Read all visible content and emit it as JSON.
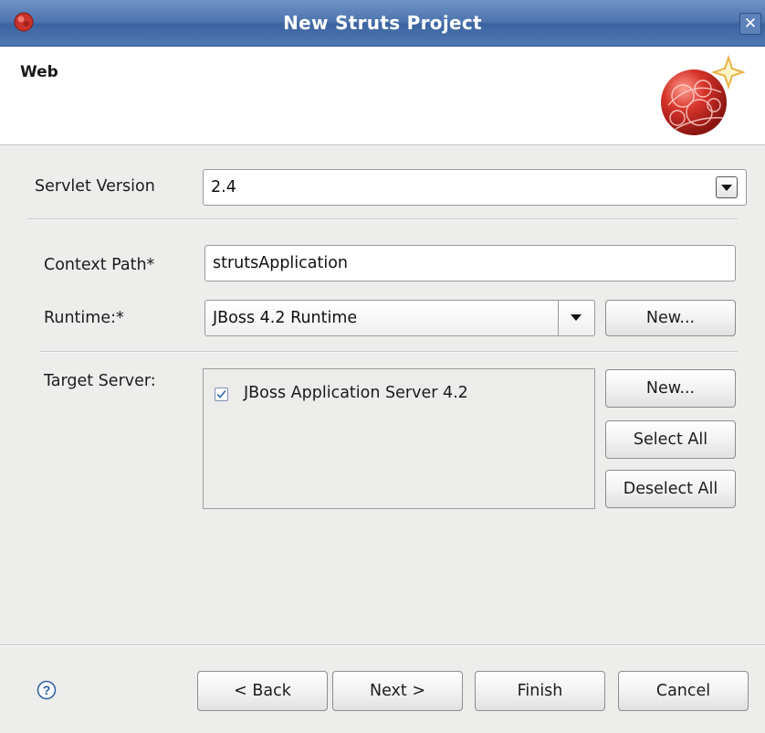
{
  "window": {
    "title": "New Struts Project"
  },
  "banner": {
    "title": "Web"
  },
  "form": {
    "servlet_version": {
      "label": "Servlet Version",
      "value": "2.4"
    },
    "context_path": {
      "label": "Context Path*",
      "value": "strutsApplication"
    },
    "runtime": {
      "label": "Runtime:*",
      "value": "JBoss 4.2 Runtime",
      "new_label": "New..."
    },
    "target_server": {
      "label": "Target Server:",
      "items": [
        {
          "label": "JBoss Application Server 4.2",
          "checked": true
        }
      ],
      "new_label": "New...",
      "select_all_label": "Select All",
      "deselect_all_label": "Deselect All"
    }
  },
  "footer": {
    "back_label": "Back",
    "next_label": "Next",
    "finish_label": "Finish",
    "cancel_label": "Cancel"
  },
  "icons": [
    "app-icon",
    "close-icon",
    "wizard-logo-icon",
    "help-icon",
    "dropdown-arrow-icon",
    "checkbox-checked-icon"
  ],
  "colors": {
    "titlebar": "#4d74ad",
    "check": "#3d6fb6",
    "help": "#2f5f9e"
  }
}
